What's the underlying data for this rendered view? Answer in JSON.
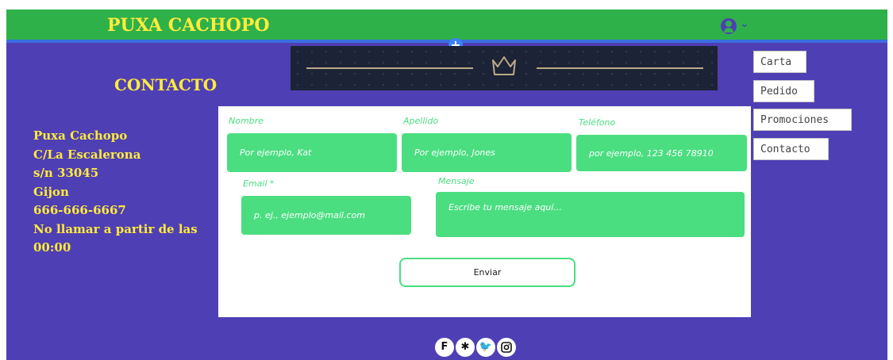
{
  "header": {
    "brand": "PUXA CACHOPO",
    "user_icon": "user-circle-icon",
    "chevron_icon": "chevron-down-icon",
    "add_icon": "plus-icon",
    "colors": {
      "topbar": "#2fb14a",
      "background": "#4f3fb4",
      "accent": "#ffeb3b"
    }
  },
  "section": {
    "title": "CONTACTO",
    "address_lines": [
      "Puxa Cachopo",
      "C/La Escalerona",
      "s/n 33045",
      "Gijon",
      "666-666-6667",
      "No llamar a partir de las",
      "00:00"
    ]
  },
  "form": {
    "nombre": {
      "label": "Nombre",
      "placeholder": "Por ejemplo, Kat"
    },
    "apellido": {
      "label": "Apellido",
      "placeholder": "Por ejemplo, Jones"
    },
    "telefono": {
      "label": "Teléfono",
      "placeholder": "por ejemplo, 123 456 78910"
    },
    "email": {
      "label": "Email *",
      "placeholder": "p. ej., ejemplo@mail.com"
    },
    "mensaje": {
      "label": "Mensaje",
      "placeholder": "Escribe tu mensaje aquí..."
    },
    "submit_label": "Enviar"
  },
  "menu": {
    "items": [
      {
        "label": "Carta"
      },
      {
        "label": "Pedido"
      },
      {
        "label": "Promociones"
      },
      {
        "label": "Contacto"
      }
    ]
  },
  "social": {
    "icons": [
      "foursquare-icon",
      "yelp-icon",
      "twitter-icon",
      "instagram-icon"
    ]
  }
}
